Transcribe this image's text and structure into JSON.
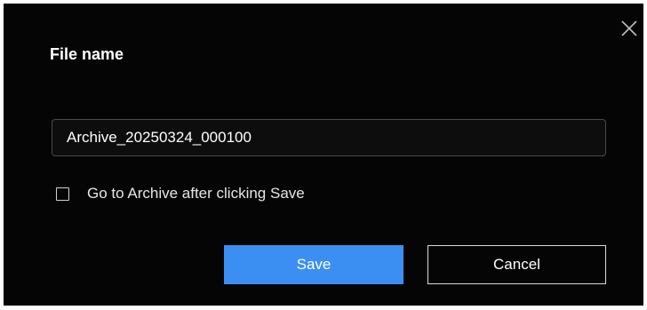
{
  "dialog": {
    "title": "File name",
    "close_icon": "close-icon",
    "filename_value": "Archive_20250324_000100",
    "checkbox_label": "Go to Archive after clicking Save",
    "checkbox_checked": false,
    "save_label": "Save",
    "cancel_label": "Cancel"
  },
  "colors": {
    "background": "#050505",
    "primary_button": "#3b8ff2",
    "text": "#ffffff"
  }
}
